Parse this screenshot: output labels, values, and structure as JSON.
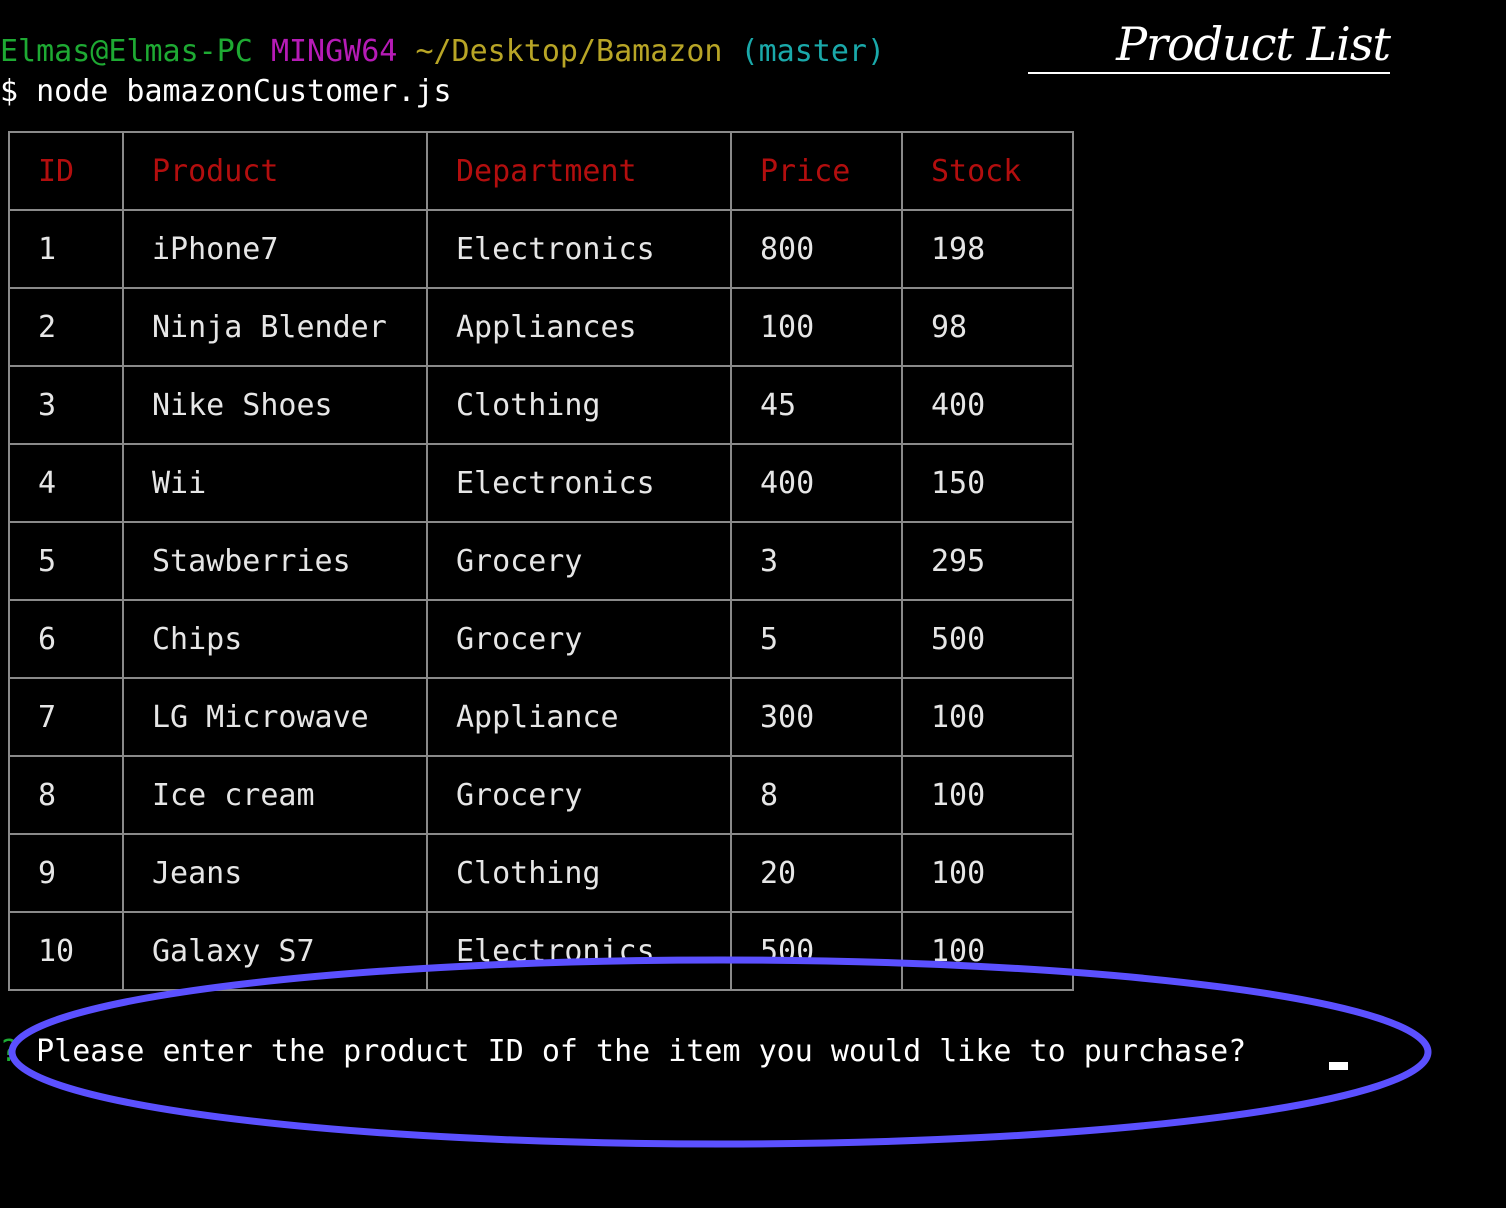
{
  "terminal": {
    "prompt": {
      "user_host": "Elmas@Elmas-PC",
      "system": "MINGW64",
      "path": "~/Desktop/Bamazon",
      "branch": "(master)"
    },
    "command": {
      "symbol": "$",
      "text": "node bamazonCustomer.js"
    }
  },
  "annotation": {
    "title": "Product List",
    "highlight_color": "#5b50ff"
  },
  "table": {
    "header_color": "#b30e0e",
    "columns": [
      "ID",
      "Product",
      "Department",
      "Price",
      "Stock"
    ],
    "rows": [
      [
        "1",
        "iPhone7",
        "Electronics",
        "800",
        "198"
      ],
      [
        "2",
        "Ninja Blender",
        "Appliances",
        "100",
        "98"
      ],
      [
        "3",
        "Nike Shoes",
        "Clothing",
        "45",
        "400"
      ],
      [
        "4",
        "Wii",
        "Electronics",
        "400",
        "150"
      ],
      [
        "5",
        "Stawberries",
        "Grocery",
        "3",
        "295"
      ],
      [
        "6",
        "Chips",
        "Grocery",
        "5",
        "500"
      ],
      [
        "7",
        "LG Microwave",
        "Appliance",
        "300",
        "100"
      ],
      [
        "8",
        "Ice cream",
        "Grocery",
        "8",
        "100"
      ],
      [
        "9",
        "Jeans",
        "Clothing",
        "20",
        "100"
      ],
      [
        "10",
        "Galaxy S7",
        "Electronics",
        "500",
        "100"
      ]
    ]
  },
  "question": {
    "marker": "?",
    "text": "Please enter the product ID of the item you would like to purchase?"
  }
}
